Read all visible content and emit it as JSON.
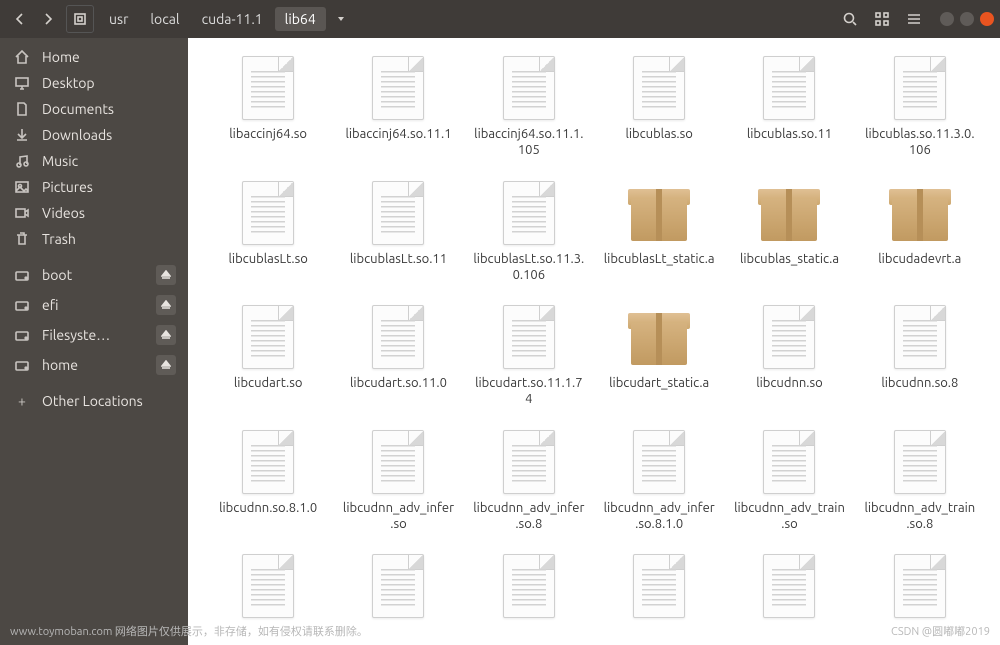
{
  "breadcrumb": {
    "segments": [
      "usr",
      "local",
      "cuda-11.1",
      "lib64"
    ],
    "activeIndex": 3
  },
  "sidebar": {
    "places": [
      {
        "icon": "home",
        "label": "Home"
      },
      {
        "icon": "desktop",
        "label": "Desktop"
      },
      {
        "icon": "documents",
        "label": "Documents"
      },
      {
        "icon": "downloads",
        "label": "Downloads"
      },
      {
        "icon": "music",
        "label": "Music"
      },
      {
        "icon": "pictures",
        "label": "Pictures"
      },
      {
        "icon": "videos",
        "label": "Videos"
      },
      {
        "icon": "trash",
        "label": "Trash"
      }
    ],
    "devices": [
      {
        "icon": "disk",
        "label": "boot",
        "eject": true
      },
      {
        "icon": "disk",
        "label": "efi",
        "eject": true
      },
      {
        "icon": "disk",
        "label": "Filesyste…",
        "eject": true
      },
      {
        "icon": "disk",
        "label": "home",
        "eject": true
      }
    ],
    "other": {
      "icon": "plus",
      "label": "Other Locations"
    }
  },
  "files": [
    {
      "name": "libaccinj64.so",
      "type": "doc"
    },
    {
      "name": "libaccinj64.so.11.1",
      "type": "doc"
    },
    {
      "name": "libaccinj64.so.11.1.105",
      "type": "doc"
    },
    {
      "name": "libcublas.so",
      "type": "doc"
    },
    {
      "name": "libcublas.so.11",
      "type": "doc"
    },
    {
      "name": "libcublas.so.11.3.0.106",
      "type": "doc"
    },
    {
      "name": "libcublasLt.so",
      "type": "doc"
    },
    {
      "name": "libcublasLt.so.11",
      "type": "doc"
    },
    {
      "name": "libcublasLt.so.11.3.0.106",
      "type": "doc"
    },
    {
      "name": "libcublasLt_static.a",
      "type": "pkg"
    },
    {
      "name": "libcublas_static.a",
      "type": "pkg"
    },
    {
      "name": "libcudadevrt.a",
      "type": "pkg"
    },
    {
      "name": "libcudart.so",
      "type": "doc"
    },
    {
      "name": "libcudart.so.11.0",
      "type": "doc"
    },
    {
      "name": "libcudart.so.11.1.74",
      "type": "doc"
    },
    {
      "name": "libcudart_static.a",
      "type": "pkg"
    },
    {
      "name": "libcudnn.so",
      "type": "doc"
    },
    {
      "name": "libcudnn.so.8",
      "type": "doc"
    },
    {
      "name": "libcudnn.so.8.1.0",
      "type": "doc"
    },
    {
      "name": "libcudnn_adv_infer.so",
      "type": "doc"
    },
    {
      "name": "libcudnn_adv_infer.so.8",
      "type": "doc"
    },
    {
      "name": "libcudnn_adv_infer.so.8.1.0",
      "type": "doc"
    },
    {
      "name": "libcudnn_adv_train.so",
      "type": "doc"
    },
    {
      "name": "libcudnn_adv_train.so.8",
      "type": "doc"
    },
    {
      "name": "",
      "type": "doc"
    },
    {
      "name": "",
      "type": "doc"
    },
    {
      "name": "",
      "type": "doc"
    },
    {
      "name": "",
      "type": "doc"
    },
    {
      "name": "",
      "type": "doc"
    },
    {
      "name": "",
      "type": "doc"
    }
  ],
  "watermarks": {
    "left": "www.toymoban.com 网络图片仅供展示，非存储，如有侵权请联系删除。",
    "right": "CSDN @圆嘟嘟2019"
  }
}
